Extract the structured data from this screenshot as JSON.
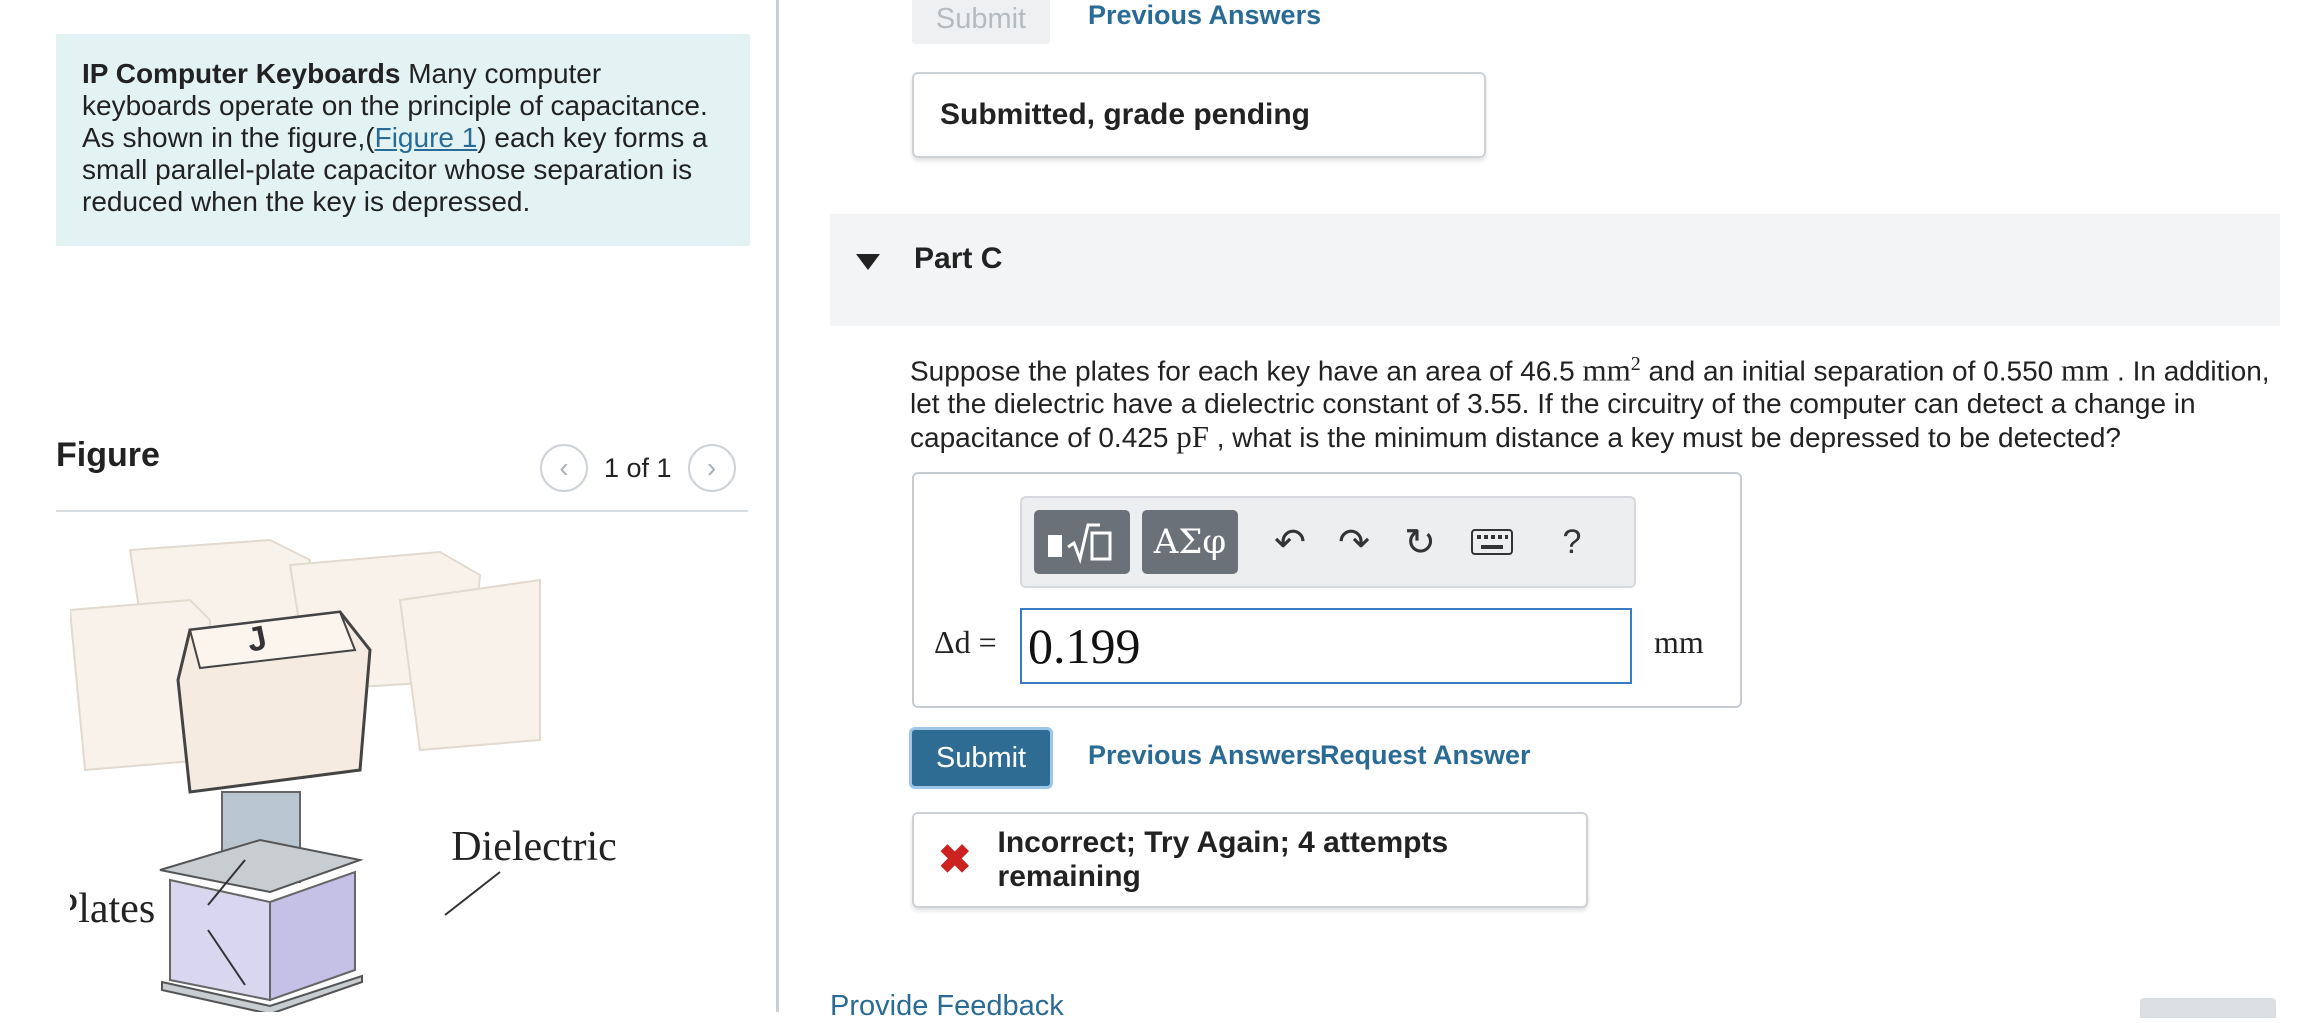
{
  "intro": {
    "title": "IP Computer Keyboards",
    "text_before_link": " Many computer keyboards operate on the principle of capacitance. As shown in the figure,(",
    "figure_link": "Figure 1",
    "text_after_link": ") each key forms a small parallel-plate capacitor whose separation is reduced when the key is depressed."
  },
  "figure_panel": {
    "heading": "Figure",
    "pager_text": "1 of 1",
    "label_dielectric": "Dielectric",
    "label_plates": "Plates",
    "key_letter": "J"
  },
  "part_b": {
    "submit_label": "Submit",
    "previous_answers": "Previous Answers",
    "status": "Submitted, grade pending"
  },
  "part_c": {
    "label": "Part C",
    "question": {
      "t1": "Suppose the plates for each key have an area of 46.5 ",
      "area_unit": "mm",
      "area_exp": "2",
      "t2": " and an initial separation of 0.550 ",
      "sep_unit": "mm",
      "t3": " . In addition, let the dielectric have a dielectric constant of 3.55. If the circuitry of the computer can detect a change in capacitance of 0.425 ",
      "cap_unit": "pF",
      "t4": " , what is the minimum distance a key must be depressed to be detected?"
    },
    "toolbar": {
      "greek_label": "ΑΣφ",
      "help_label": "?"
    },
    "variable_label": "Δd =",
    "answer_value": "0.199",
    "unit": "mm",
    "submit_label": "Submit",
    "previous_answers": "Previous Answers",
    "request_answer": "Request Answer",
    "feedback_text": "Incorrect; Try Again; 4 attempts remaining"
  },
  "footer": {
    "provide_feedback": "Provide Feedback"
  },
  "colors": {
    "link": "#2a6b96",
    "submit_bg": "#2e6c94",
    "intro_bg": "#e3f3f4",
    "error": "#cc2222"
  }
}
